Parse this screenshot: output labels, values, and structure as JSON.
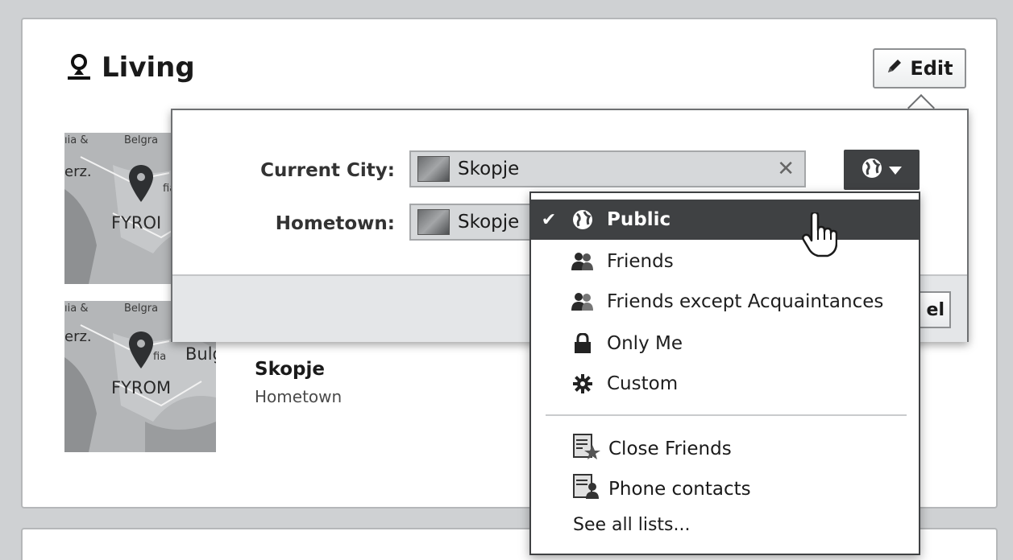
{
  "section": {
    "title": "Living",
    "edit_label": "Edit"
  },
  "maps": {
    "top_labels": [
      "ıia &",
      "Belgra",
      "erz.",
      "fia",
      "FYROI"
    ],
    "bottom_labels": [
      "ıia &",
      "Belgra",
      "erz.",
      "fia",
      "Bulg",
      "FYROM"
    ]
  },
  "entries": {
    "hometown_name": "Skopje",
    "hometown_sub": "Hometown"
  },
  "edit_panel": {
    "current_city_label": "Current City:",
    "current_city_value": "Skopje",
    "hometown_label": "Hometown:",
    "hometown_value": "Skopje",
    "clear_symbol": "✕",
    "cancel_partial": "el"
  },
  "privacy_menu": {
    "selected": "Public",
    "check_symbol": "✔",
    "options": [
      {
        "label": "Public",
        "icon": "globe-icon"
      },
      {
        "label": "Friends",
        "icon": "friends-icon"
      },
      {
        "label": "Friends except Acquaintances",
        "icon": "friends-except-icon"
      },
      {
        "label": "Only Me",
        "icon": "lock-icon"
      },
      {
        "label": "Custom",
        "icon": "gear-icon"
      }
    ],
    "lists": [
      {
        "label": "Close Friends",
        "icon": "close-friends-icon"
      },
      {
        "label": "Phone contacts",
        "icon": "phone-contacts-icon"
      }
    ],
    "see_all": "See all lists..."
  },
  "colors": {
    "selected_bg": "#3f4143",
    "page_bg": "#cfd1d3",
    "card_bg": "#ffffff"
  }
}
